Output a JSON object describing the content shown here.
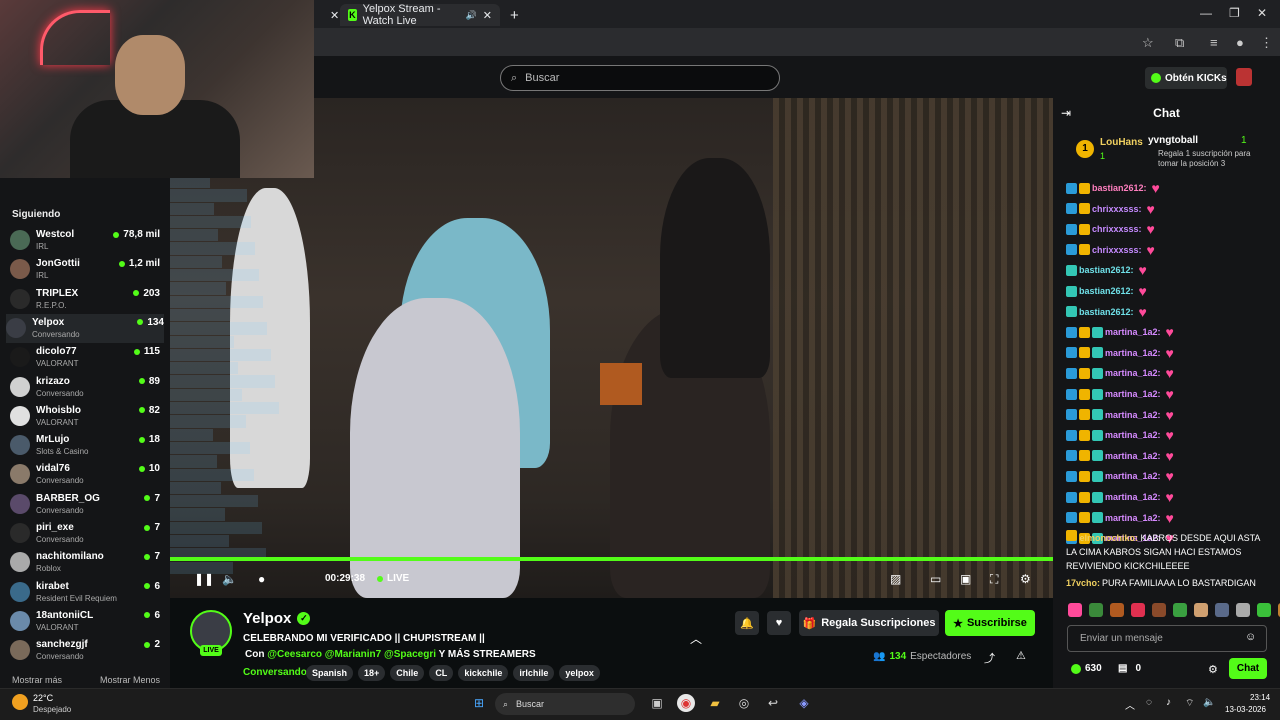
{
  "browser": {
    "active_tab": "Yelpox Stream - Watch Live",
    "new_tab_icon": "plus-icon"
  },
  "site": {
    "search_placeholder": "Buscar",
    "get_kicks_label": "Obtén KICKs"
  },
  "sidebar": {
    "heading": "Siguiendo",
    "items": [
      {
        "name": "Westcol",
        "sub": "IRL",
        "count": "78,8 mil",
        "color": "#4a6a55"
      },
      {
        "name": "JonGottii",
        "sub": "IRL",
        "count": "1,2 mil",
        "color": "#7a5a4a"
      },
      {
        "name": "TRIPLEX",
        "sub": "R.E.P.O.",
        "count": "203",
        "color": "#2a2a2a"
      },
      {
        "name": "Yelpox",
        "sub": "Conversando",
        "count": "134",
        "color": "#3a3d45"
      },
      {
        "name": "dicolo77",
        "sub": "VALORANT",
        "count": "115",
        "color": "#1a1a1a"
      },
      {
        "name": "krizazo",
        "sub": "Conversando",
        "count": "89",
        "color": "#d0d0d0"
      },
      {
        "name": "Whoisblo",
        "sub": "VALORANT",
        "count": "82",
        "color": "#e0e0e0"
      },
      {
        "name": "MrLujo",
        "sub": "Slots & Casino",
        "count": "18",
        "color": "#4a5a6a"
      },
      {
        "name": "vidal76",
        "sub": "Conversando",
        "count": "10",
        "color": "#8a7a6a"
      },
      {
        "name": "BARBER_OG",
        "sub": "Conversando",
        "count": "7",
        "color": "#5a4a6a"
      },
      {
        "name": "piri_exe",
        "sub": "Conversando",
        "count": "7",
        "color": "#2a2a2a"
      },
      {
        "name": "nachitomilano",
        "sub": "Roblox",
        "count": "7",
        "color": "#aaaaaa"
      },
      {
        "name": "kirabet",
        "sub": "Resident Evil Requiem",
        "count": "6",
        "color": "#3a6a8a"
      },
      {
        "name": "18antoniiCL",
        "sub": "VALORANT",
        "count": "6",
        "color": "#6a8aaa"
      },
      {
        "name": "sanchezgjf",
        "sub": "Conversando",
        "count": "2",
        "color": "#7a6a5a"
      }
    ],
    "show_more": "Mostrar más",
    "show_less": "Mostrar Menos"
  },
  "player": {
    "time": "00:29:38",
    "live_label": "LIVE",
    "progress": 1.0
  },
  "stream": {
    "live_badge": "LIVE",
    "streamer": "Yelpox",
    "title": "CELEBRANDO MI VERIFICADO || CHUPISTREAM ||",
    "collab_prefix": "Con",
    "collab_mentions": "@Ceesarco @Marianin7 @Spacegri",
    "collab_suffix": "Y MÁS STREAMERS",
    "category": "Conversando",
    "tags": [
      "Spanish",
      "18+",
      "Chile",
      "CL",
      "kickchile",
      "irlchile",
      "yelpox"
    ],
    "gift_label": "Regala Suscripciones",
    "subscribe_label": "Suscribirse",
    "viewer_count": "134",
    "viewer_label": "Espectadores"
  },
  "chat": {
    "title": "Chat",
    "pinned_rank": "1",
    "pinned_user": "LouHans",
    "pinned_user_count": "1",
    "gift_user": "yvngtoball",
    "gift_count": "1",
    "gift_text": "Regala 1 suscripción para tomar la posición 3",
    "messages": [
      {
        "user": "bastian2612:",
        "color": "#ff7fbf",
        "badges": [
          "#2a9bd8",
          "#f0b400"
        ]
      },
      {
        "user": "chrixxxsss:",
        "color": "#c58aff",
        "badges": [
          "#2a9bd8",
          "#f0b400"
        ]
      },
      {
        "user": "chrixxxsss:",
        "color": "#c58aff",
        "badges": [
          "#2a9bd8",
          "#f0b400"
        ]
      },
      {
        "user": "chrixxxsss:",
        "color": "#c58aff",
        "badges": [
          "#2a9bd8",
          "#f0b400"
        ]
      },
      {
        "user": "bastian2612:",
        "color": "#6fe0e8",
        "badges": [
          "#33c7b5"
        ]
      },
      {
        "user": "bastian2612:",
        "color": "#6fe0e8",
        "badges": [
          "#33c7b5"
        ]
      },
      {
        "user": "bastian2612:",
        "color": "#6fe0e8",
        "badges": [
          "#33c7b5"
        ]
      },
      {
        "user": "martina_1a2:",
        "color": "#d68aff",
        "badges": [
          "#2a9bd8",
          "#f0b400",
          "#33c7b5"
        ]
      },
      {
        "user": "martina_1a2:",
        "color": "#d68aff",
        "badges": [
          "#2a9bd8",
          "#f0b400",
          "#33c7b5"
        ]
      },
      {
        "user": "martina_1a2:",
        "color": "#d68aff",
        "badges": [
          "#2a9bd8",
          "#f0b400",
          "#33c7b5"
        ]
      },
      {
        "user": "martina_1a2:",
        "color": "#d68aff",
        "badges": [
          "#2a9bd8",
          "#f0b400",
          "#33c7b5"
        ]
      },
      {
        "user": "martina_1a2:",
        "color": "#d68aff",
        "badges": [
          "#2a9bd8",
          "#f0b400",
          "#33c7b5"
        ]
      },
      {
        "user": "martina_1a2:",
        "color": "#d68aff",
        "badges": [
          "#2a9bd8",
          "#f0b400",
          "#33c7b5"
        ]
      },
      {
        "user": "martina_1a2:",
        "color": "#d68aff",
        "badges": [
          "#2a9bd8",
          "#f0b400",
          "#33c7b5"
        ]
      },
      {
        "user": "martina_1a2:",
        "color": "#d68aff",
        "badges": [
          "#2a9bd8",
          "#f0b400",
          "#33c7b5"
        ]
      },
      {
        "user": "martina_1a2:",
        "color": "#d68aff",
        "badges": [
          "#2a9bd8",
          "#f0b400",
          "#33c7b5"
        ]
      },
      {
        "user": "martina_1a2:",
        "color": "#d68aff",
        "badges": [
          "#2a9bd8",
          "#f0b400",
          "#33c7b5"
        ]
      },
      {
        "user": "martina_1a2:",
        "color": "#d68aff",
        "badges": [
          "#2a9bd8",
          "#f0b400",
          "#33c7b5"
        ]
      }
    ],
    "long_user": "elmonochiko:",
    "long_text": "KABROS DESDE AQUI ASTA LA CIMA KABROS SIGAN HACI ESTAMOS REVIVIENDO KICKCHILEEEE",
    "last_user": "17vcho:",
    "last_text": "PURA FAMILIAAA LO BASTARDIGAN",
    "input_placeholder": "Enviar un mensaje",
    "kicks_balance": "630",
    "gift_balance": "0",
    "send_label": "Chat"
  },
  "taskbar": {
    "temperature": "22°C",
    "weather": "Despejado",
    "search_label": "Buscar",
    "time": "23:14",
    "date": "13-03-2026"
  }
}
